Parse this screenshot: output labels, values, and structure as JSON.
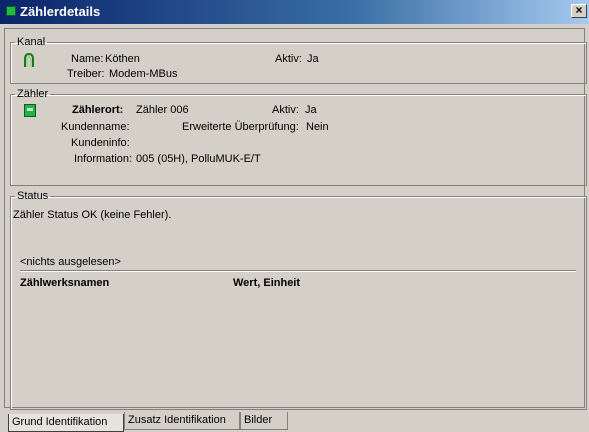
{
  "window": {
    "title": "Zählerdetails",
    "close": "×"
  },
  "kanal": {
    "legend": "Kanal",
    "name_label": "Name:",
    "name_value": "Köthen",
    "aktiv_label": "Aktiv:",
    "aktiv_value": "Ja",
    "treiber_label": "Treiber:",
    "treiber_value": "Modem-MBus"
  },
  "zaehler": {
    "legend": "Zähler",
    "ort_label": "Zählerort:",
    "ort_value": "Zähler 006",
    "aktiv_label": "Aktiv:",
    "aktiv_value": "Ja",
    "kundenname_label": "Kundenname:",
    "erweitert_label": "Erweiterte Überprüfung:",
    "erweitert_value": "Nein",
    "kundeninfo_label": "Kundeninfo:",
    "info_label": "Information:",
    "info_value": "005 (05H), PolluMUK-E/T"
  },
  "status": {
    "legend": "Status",
    "message": "Zähler Status OK (keine Fehler).",
    "not_read": "<nichts ausgelesen>",
    "col_names": "Zählwerksnamen",
    "col_value": "Wert, Einheit"
  },
  "tabs": [
    {
      "label": "Grund Identifikation",
      "active": true
    },
    {
      "label": "Zusatz Identifikation"
    },
    {
      "label": "Bilder"
    }
  ]
}
